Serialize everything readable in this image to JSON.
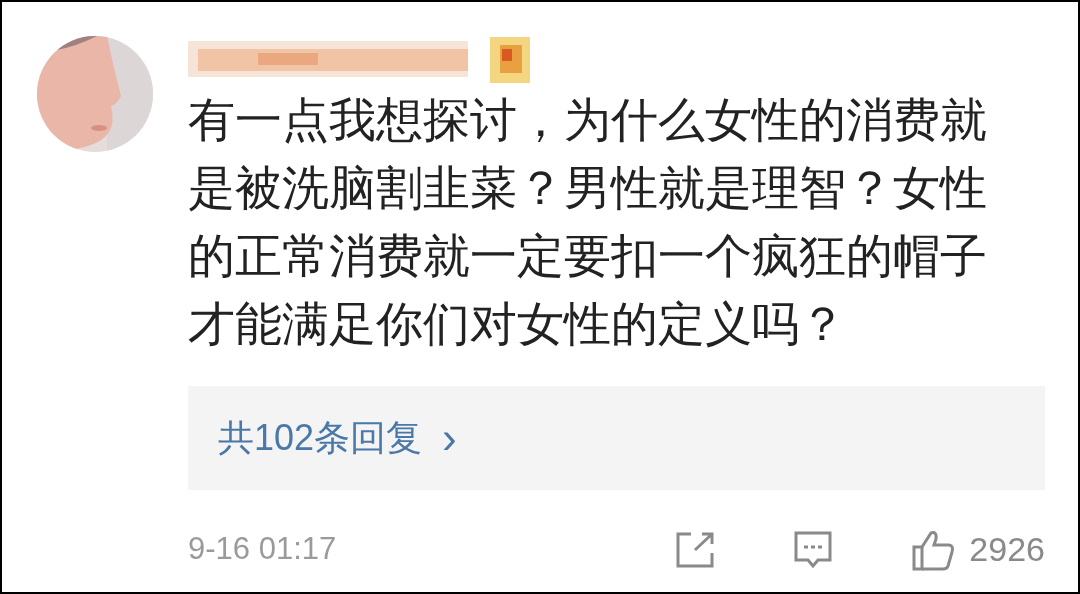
{
  "comment": {
    "text": "有一点我想探讨，为什么女性的消费就是被洗脑割韭菜？男性就是理智？女性的正常消费就一定要扣一个疯狂的帽子才能满足你们对女性的定义吗？",
    "replies_link": "共102条回复",
    "replies_chevron": "›",
    "time": "9-16 01:17",
    "likes": "2926"
  }
}
